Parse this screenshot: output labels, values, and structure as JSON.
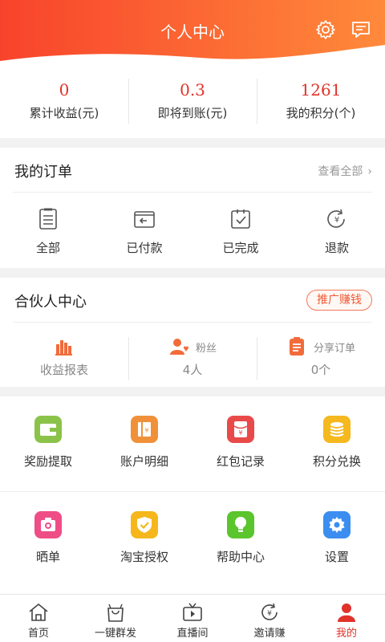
{
  "header": {
    "title": "个人中心"
  },
  "stats": [
    {
      "value": "0",
      "label": "累计收益(元)"
    },
    {
      "value": "0.3",
      "label": "即将到账(元)"
    },
    {
      "value": "1261",
      "label": "我的积分(个)"
    }
  ],
  "orders": {
    "title": "我的订单",
    "view_all": "查看全部",
    "items": [
      {
        "label": "全部",
        "icon": "list-icon"
      },
      {
        "label": "已付款",
        "icon": "paid-icon"
      },
      {
        "label": "已完成",
        "icon": "done-icon"
      },
      {
        "label": "退款",
        "icon": "refund-icon"
      }
    ]
  },
  "partner": {
    "title": "合伙人中心",
    "promo_label": "推广赚钱",
    "report_label": "收益报表",
    "fans_label": "粉丝",
    "fans_value": "4人",
    "share_label": "分享订单",
    "share_value": "0个"
  },
  "menu": {
    "row1": [
      {
        "label": "奖励提取",
        "icon": "wallet-icon",
        "color": "#8bc34a"
      },
      {
        "label": "账户明细",
        "icon": "ledger-icon",
        "color": "#f0913a"
      },
      {
        "label": "红包记录",
        "icon": "red-envelope-icon",
        "color": "#e84a4a"
      },
      {
        "label": "积分兑换",
        "icon": "coins-icon",
        "color": "#f5b91e"
      }
    ],
    "row2": [
      {
        "label": "晒单",
        "icon": "camera-icon",
        "color": "#ef4d86"
      },
      {
        "label": "淘宝授权",
        "icon": "shield-icon",
        "color": "#f6b71c"
      },
      {
        "label": "帮助中心",
        "icon": "bulb-icon",
        "color": "#5ac52d"
      },
      {
        "label": "设置",
        "icon": "settings-icon",
        "color": "#3b8ef0"
      }
    ]
  },
  "tabs": [
    {
      "label": "首页"
    },
    {
      "label": "一键群发"
    },
    {
      "label": "直播间"
    },
    {
      "label": "邀请赚"
    },
    {
      "label": "我的"
    }
  ],
  "colors": {
    "accent": "#e0322a",
    "header_start": "#f8432c",
    "header_end": "#ff8a3a"
  }
}
